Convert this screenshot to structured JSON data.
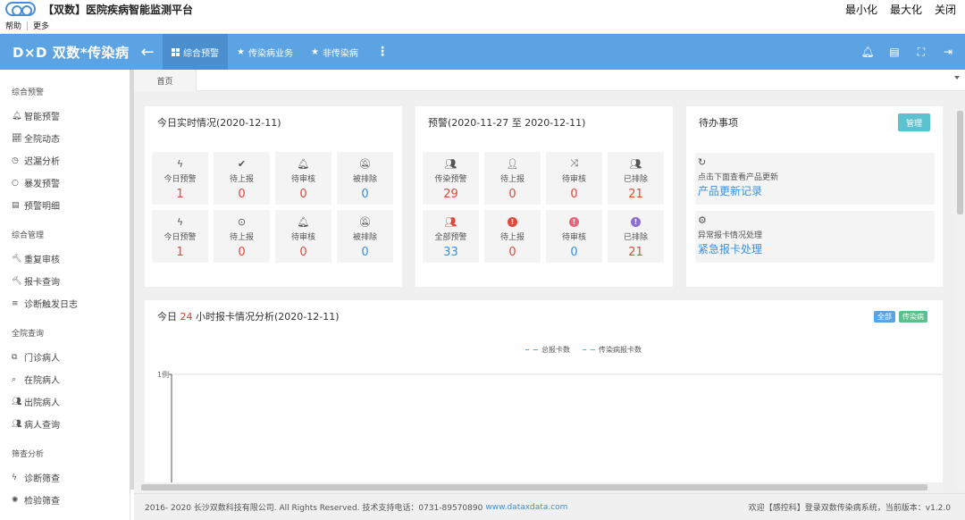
{
  "window": {
    "title": "【双数】医院疾病智能监测平台",
    "minimize": "最小化",
    "maximize": "最大化",
    "close": "关闭"
  },
  "menubar": {
    "help": "帮助",
    "more": "更多"
  },
  "header": {
    "brand": "D×D 双数*传染病",
    "tabs": [
      {
        "label": "综合预警",
        "icon": "grid-icon"
      },
      {
        "label": "传染病业务",
        "icon": "star-icon"
      },
      {
        "label": "非传染病",
        "icon": "star-icon"
      }
    ],
    "accent": "#5ba3e3"
  },
  "sidebar": {
    "groups": [
      {
        "title": "综合预警",
        "items": [
          {
            "label": "智能预警",
            "icon": "bell-icon"
          },
          {
            "label": "全院动态",
            "icon": "chart-line-icon"
          },
          {
            "label": "迟漏分析",
            "icon": "clock-icon"
          },
          {
            "label": "暴发预警",
            "icon": "circle-icon"
          },
          {
            "label": "预警明细",
            "icon": "file-icon"
          }
        ]
      },
      {
        "title": "综合管理",
        "items": [
          {
            "label": "重复审核",
            "icon": "gavel-icon"
          },
          {
            "label": "报卡查询",
            "icon": "gavel-icon"
          },
          {
            "label": "诊断触发日志",
            "icon": "list-icon"
          }
        ]
      },
      {
        "title": "全院查询",
        "items": [
          {
            "label": "门诊病人",
            "icon": "copy-icon"
          },
          {
            "label": "在院病人",
            "icon": "search-icon"
          },
          {
            "label": "出院病人",
            "icon": "users-icon"
          },
          {
            "label": "病人查询",
            "icon": "users-icon"
          }
        ]
      },
      {
        "title": "筛查分析",
        "items": [
          {
            "label": "诊断筛查",
            "icon": "bolt-icon"
          },
          {
            "label": "检验筛查",
            "icon": "spinner-icon"
          }
        ]
      }
    ]
  },
  "tabbar": {
    "home": "首页"
  },
  "realtime": {
    "title": "今日实时情况(2020-12-11)",
    "row1": [
      {
        "label": "今日预警",
        "value": "1"
      },
      {
        "label": "待上报",
        "value": "0"
      },
      {
        "label": "待审核",
        "value": "0"
      },
      {
        "label": "被排除",
        "value": "0"
      }
    ],
    "row2": [
      {
        "label": "今日预警",
        "value": "1"
      },
      {
        "label": "待上报",
        "value": "0"
      },
      {
        "label": "待审核",
        "value": "0"
      },
      {
        "label": "被排除",
        "value": "0"
      }
    ]
  },
  "warning": {
    "title": "预警(2020-11-27 至 2020-12-11)",
    "row1": [
      {
        "label": "传染预警",
        "value": "29"
      },
      {
        "label": "待上报",
        "value": "0"
      },
      {
        "label": "待审核",
        "value": "0"
      },
      {
        "label": "已排除",
        "value": "21"
      }
    ],
    "row2": [
      {
        "label": "全部预警",
        "value": "33"
      },
      {
        "label": "待上报",
        "value": "0"
      },
      {
        "label": "待审核",
        "value": "0"
      },
      {
        "label": "已排除",
        "value": "21"
      }
    ]
  },
  "todo": {
    "title": "待办事项",
    "manage": "管理",
    "items": [
      {
        "label": "点击下面查看产品更新",
        "link": "产品更新记录"
      },
      {
        "label": "异常报卡情况处理",
        "link": "紧急报卡处理"
      }
    ]
  },
  "chart_panel": {
    "title_prefix": "今日",
    "title_hours": "24",
    "title_suffix": "小时报卡情况分析(2020-12-11)",
    "badge_all": "全部",
    "badge_infectious": "传染病"
  },
  "chart_data": {
    "type": "line",
    "series": [
      {
        "name": "总报卡数",
        "values": []
      },
      {
        "name": "传染病报卡数",
        "values": []
      }
    ],
    "ytick_top": "1例",
    "colors": [
      "#5ba3e3",
      "#5cc2a8"
    ]
  },
  "footer": {
    "copyright": "2016- 2020 长沙双数科技有限公司. All Rights Reserved. 技术支持电话：0731-89570890",
    "url": "www.dataxdata.com",
    "welcome": "欢迎【感控科】登录双数传染病系统，当前版本：v1.2.0"
  }
}
